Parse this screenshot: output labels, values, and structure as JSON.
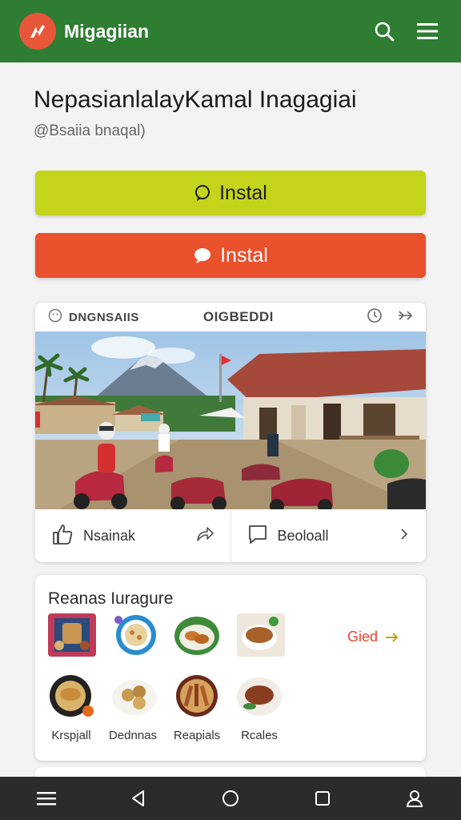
{
  "header": {
    "app_title": "Migagiian",
    "logo_icon": "leaf-logo-icon",
    "search_icon": "search-icon",
    "menu_icon": "hamburger-menu-icon",
    "bar_color": "#2e7d32"
  },
  "page": {
    "title": "NepasianlalayKamal Inagagiai",
    "subtitle": "@Bsaiia bnaqal)"
  },
  "buttons": {
    "primary_label": "Instal",
    "primary_color": "#c4d41a",
    "secondary_label": "Instal",
    "secondary_color": "#e9502c"
  },
  "post": {
    "header_left": "DNGNSAIIS",
    "header_mid": "OIGBEDDI",
    "action_like": "Nsainak",
    "action_comment": "Beoloall"
  },
  "food": {
    "title": "Reanas Iuragure",
    "see_more": "Gied",
    "labels": [
      "Krspjall",
      "Dednnas",
      "Reapials",
      "Rcales"
    ]
  },
  "navbar": {
    "icons": [
      "menu-icon",
      "back-icon",
      "home-icon",
      "recents-icon",
      "profile-icon"
    ]
  }
}
